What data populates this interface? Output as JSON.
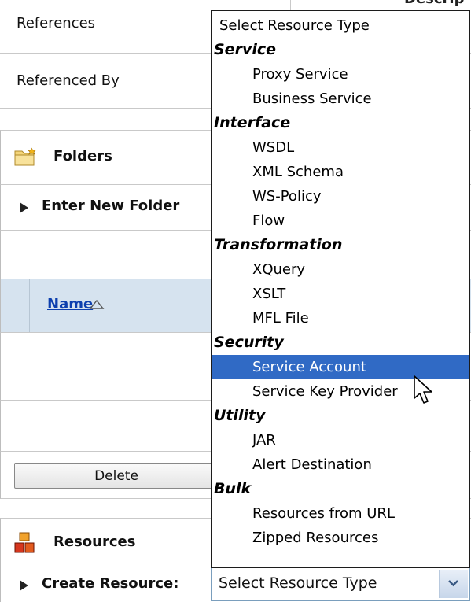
{
  "header": {
    "description_label": "Descrip"
  },
  "references": {
    "label": "References"
  },
  "referenced_by": {
    "label": "Referenced By"
  },
  "folders": {
    "title": "Folders",
    "icon": "folder-icon",
    "enter_new_folder_label": "Enter New Folder"
  },
  "table": {
    "name_column_label": "Name",
    "sort_icon": "sort-ascending-icon"
  },
  "delete_button": {
    "label": "Delete"
  },
  "resources": {
    "title": "Resources",
    "icon": "resources-icon",
    "create_resource_label": "Create Resource:"
  },
  "resource_type_select": {
    "selected_value": "Select Resource Type",
    "dropdown_items": [
      {
        "label": "Select Resource Type",
        "kind": "plain"
      },
      {
        "label": "Service",
        "kind": "category"
      },
      {
        "label": "Proxy Service",
        "kind": "option"
      },
      {
        "label": "Business Service",
        "kind": "option"
      },
      {
        "label": "Interface",
        "kind": "category"
      },
      {
        "label": "WSDL",
        "kind": "option"
      },
      {
        "label": "XML Schema",
        "kind": "option"
      },
      {
        "label": "WS-Policy",
        "kind": "option"
      },
      {
        "label": "Flow",
        "kind": "option"
      },
      {
        "label": "Transformation",
        "kind": "category"
      },
      {
        "label": "XQuery",
        "kind": "option"
      },
      {
        "label": "XSLT",
        "kind": "option"
      },
      {
        "label": "MFL File",
        "kind": "option"
      },
      {
        "label": "Security",
        "kind": "category"
      },
      {
        "label": "Service Account",
        "kind": "option",
        "highlighted": true
      },
      {
        "label": "Service Key Provider",
        "kind": "option"
      },
      {
        "label": "Utility",
        "kind": "category"
      },
      {
        "label": "JAR",
        "kind": "option"
      },
      {
        "label": "Alert Destination",
        "kind": "option"
      },
      {
        "label": "Bulk",
        "kind": "category"
      },
      {
        "label": "Resources from URL",
        "kind": "option"
      },
      {
        "label": "Zipped Resources",
        "kind": "option"
      }
    ]
  },
  "colors": {
    "highlight": "#306ac5",
    "table_header_bg": "#d6e3ef",
    "link": "#0d3fae"
  }
}
